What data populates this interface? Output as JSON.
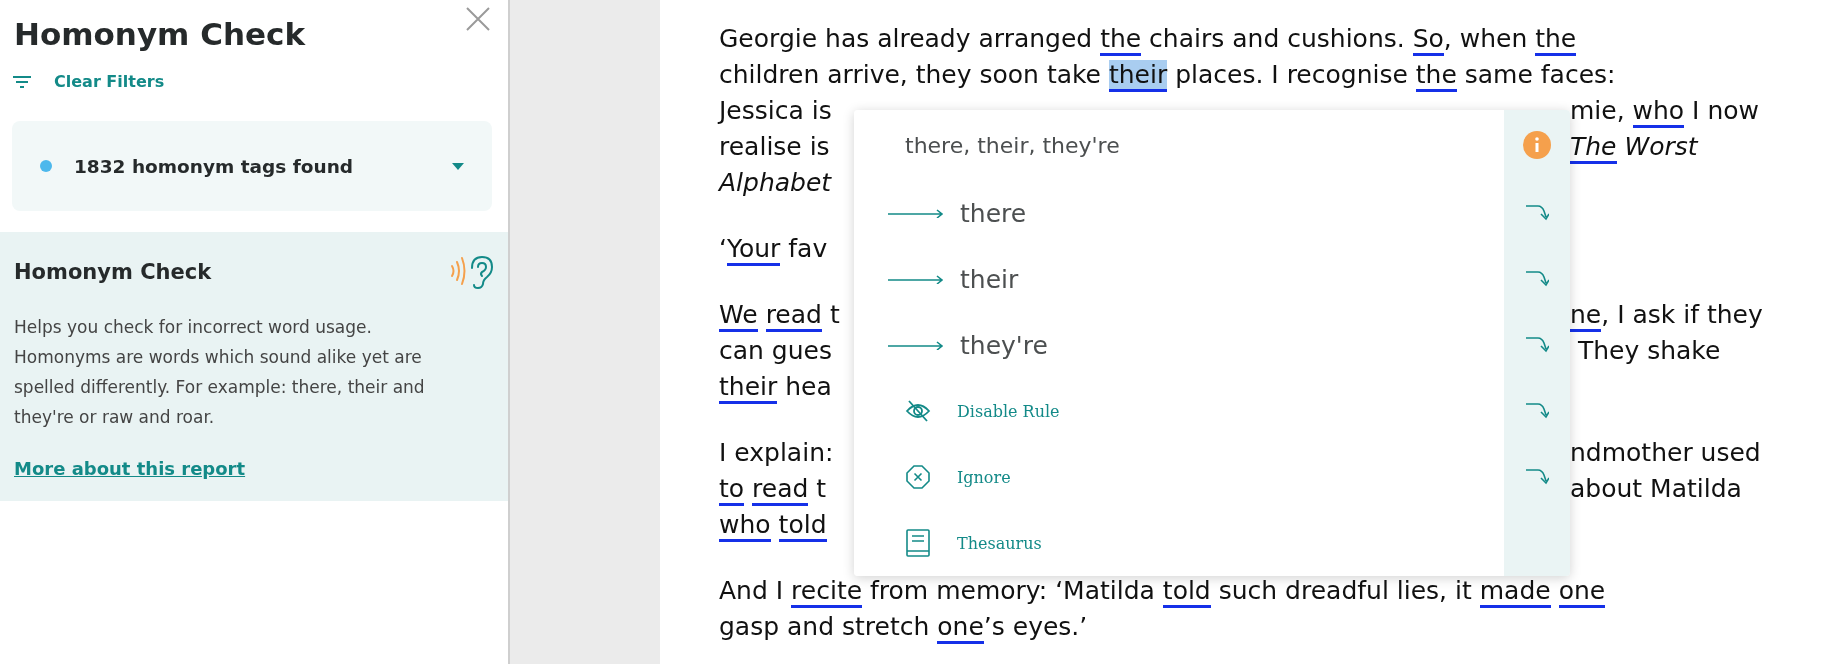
{
  "panel": {
    "title": "Homonym Check",
    "filter_action": "Clear Filters",
    "summary": {
      "text": "1832 homonym tags found",
      "color": "#4db8ec"
    },
    "info": {
      "title": "Homonym Check",
      "description": "Helps you check for incorrect word usage. Homonyms are words which sound alike yet are spelled differently. For example: there, their and they're or raw and roar.",
      "link": "More about this report"
    }
  },
  "document": {
    "paragraphs": [
      {
        "lines": [
          {
            "full": [
              {
                "kind": "text",
                "text": "Georgie has already arranged "
              },
              {
                "kind": "tag",
                "text": "the"
              },
              {
                "kind": "text",
                "text": " chairs and cushions. "
              },
              {
                "kind": "tag",
                "text": "So"
              },
              {
                "kind": "text",
                "text": ", when "
              },
              {
                "kind": "tag",
                "text": "the"
              }
            ]
          },
          {
            "full": [
              {
                "kind": "text",
                "text": "children arrive, they soon take "
              },
              {
                "kind": "current-tag",
                "text": "their"
              },
              {
                "kind": "text",
                "text": " places. I recognise "
              },
              {
                "kind": "tag",
                "text": "the"
              },
              {
                "kind": "text",
                "text": " same faces:"
              }
            ]
          },
          {
            "left": [
              {
                "kind": "text",
                "text": "Jessica is"
              }
            ],
            "right": [
              {
                "kind": "text",
                "text": "mie, "
              },
              {
                "kind": "tag",
                "text": "who"
              },
              {
                "kind": "text",
                "text": " I now"
              }
            ]
          },
          {
            "left": [
              {
                "kind": "text",
                "text": "realise is"
              }
            ],
            "right": [
              {
                "kind": "italic-tag",
                "text": "The"
              },
              {
                "kind": "italic",
                "text": " Worst"
              }
            ]
          },
          {
            "left": [
              {
                "kind": "italic",
                "text": "Alphabet"
              }
            ]
          }
        ]
      },
      {
        "lines": [
          {
            "left": [
              {
                "kind": "text",
                "text": "‘"
              },
              {
                "kind": "tag",
                "text": "Your"
              },
              {
                "kind": "text",
                "text": " fav"
              }
            ]
          }
        ]
      },
      {
        "lines": [
          {
            "left": [
              {
                "kind": "tag",
                "text": "We"
              },
              {
                "kind": "tag",
                "text": "read"
              },
              {
                "kind": "text",
                "text": " t"
              }
            ],
            "right": [
              {
                "kind": "tag",
                "text": "ne"
              },
              {
                "kind": "text",
                "text": ", I ask if they"
              }
            ]
          },
          {
            "left": [
              {
                "kind": "text",
                "text": "can gues"
              }
            ],
            "right": [
              {
                "kind": "text",
                "text": " They shake"
              }
            ]
          },
          {
            "left": [
              {
                "kind": "tag",
                "text": "their"
              },
              {
                "kind": "text",
                "text": " hea"
              }
            ]
          }
        ]
      },
      {
        "lines": [
          {
            "left": [
              {
                "kind": "text",
                "text": "I explain:"
              }
            ],
            "right": [
              {
                "kind": "text",
                "text": "ndmother used"
              }
            ]
          },
          {
            "left": [
              {
                "kind": "tag",
                "text": "to"
              },
              {
                "kind": "tag",
                "text": "read"
              },
              {
                "kind": "text",
                "text": " t"
              }
            ],
            "right": [
              {
                "kind": "text",
                "text": "about Matilda"
              }
            ]
          },
          {
            "left": [
              {
                "kind": "tag",
                "text": "who"
              },
              {
                "kind": "tag",
                "text": "told"
              }
            ]
          }
        ]
      },
      {
        "lines": [
          {
            "full": [
              {
                "kind": "text",
                "text": "And I "
              },
              {
                "kind": "tag",
                "text": "recite"
              },
              {
                "kind": "text",
                "text": " from memory: ‘Matilda "
              },
              {
                "kind": "tag",
                "text": "told"
              },
              {
                "kind": "text",
                "text": " such dreadful lies, it "
              },
              {
                "kind": "tag",
                "text": "made"
              },
              {
                "kind": "tag",
                "text": "one"
              }
            ]
          },
          {
            "full": [
              {
                "kind": "text",
                "text": "gasp and stretch "
              },
              {
                "kind": "tag",
                "text": "one"
              },
              {
                "kind": "text",
                "text": "’s eyes.’"
              }
            ]
          }
        ]
      }
    ]
  },
  "popup": {
    "heading": "there, their, they're",
    "suggestions": [
      {
        "text": "there"
      },
      {
        "text": "their"
      },
      {
        "text": "they're"
      }
    ],
    "actions": [
      {
        "kind": "disable",
        "label": "Disable Rule"
      },
      {
        "kind": "ignore",
        "label": "Ignore"
      },
      {
        "kind": "thesaurus",
        "label": "Thesaurus"
      }
    ]
  }
}
